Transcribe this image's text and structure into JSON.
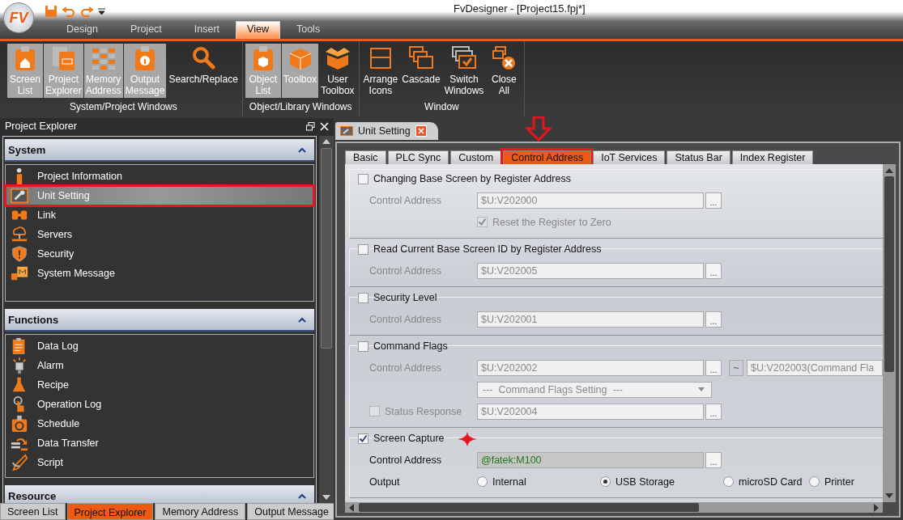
{
  "window": {
    "title": "FvDesigner - [Project15.fpj*]",
    "logo_text": "FV"
  },
  "ribbon_tabs": [
    {
      "label": "Design",
      "selected": false
    },
    {
      "label": "Project",
      "selected": false
    },
    {
      "label": "Insert",
      "selected": false
    },
    {
      "label": "View",
      "selected": true
    },
    {
      "label": "Tools",
      "selected": false
    }
  ],
  "ribbon_groups": [
    {
      "label": "System/Project Windows",
      "buttons": [
        {
          "label": "Screen\nList",
          "on": true
        },
        {
          "label": "Project\nExplorer",
          "on": true
        },
        {
          "label": "Memory\nAddress",
          "on": true
        },
        {
          "label": "Output\nMessage",
          "on": true
        },
        {
          "label": "Search/Replace",
          "on": false
        }
      ]
    },
    {
      "label": "Object/Library Windows",
      "buttons": [
        {
          "label": "Object\nList",
          "on": true
        },
        {
          "label": "Toolbox",
          "on": true
        },
        {
          "label": "User\nToolbox",
          "on": false
        }
      ]
    },
    {
      "label": "Window",
      "buttons": [
        {
          "label": "Arrange\nIcons",
          "on": false
        },
        {
          "label": "Cascade",
          "on": false
        },
        {
          "label": "Switch\nWindows",
          "on": false
        },
        {
          "label": "Close\nAll",
          "on": false
        }
      ]
    }
  ],
  "explorer": {
    "title": "Project Explorer",
    "sections": [
      {
        "title": "System",
        "expanded": true,
        "items": [
          {
            "label": "Project Information",
            "selected": false,
            "highlighted": false
          },
          {
            "label": "Unit Setting",
            "selected": true,
            "highlighted": true
          },
          {
            "label": "Link",
            "selected": false,
            "highlighted": false
          },
          {
            "label": "Servers",
            "selected": false,
            "highlighted": false
          },
          {
            "label": "Security",
            "selected": false,
            "highlighted": false
          },
          {
            "label": "System Message",
            "selected": false,
            "highlighted": false
          }
        ]
      },
      {
        "title": "Functions",
        "expanded": true,
        "items": [
          {
            "label": "Data Log",
            "selected": false,
            "highlighted": false
          },
          {
            "label": "Alarm",
            "selected": false,
            "highlighted": false
          },
          {
            "label": "Recipe",
            "selected": false,
            "highlighted": false
          },
          {
            "label": "Operation Log",
            "selected": false,
            "highlighted": false
          },
          {
            "label": "Schedule",
            "selected": false,
            "highlighted": false
          },
          {
            "label": "Data Transfer",
            "selected": false,
            "highlighted": false
          },
          {
            "label": "Script",
            "selected": false,
            "highlighted": false
          }
        ]
      },
      {
        "title": "Resource",
        "expanded": true
      }
    ]
  },
  "bottom_tabs": [
    {
      "label": "Screen List",
      "selected": false
    },
    {
      "label": "Project Explorer",
      "selected": true
    },
    {
      "label": "Memory Address",
      "selected": false
    },
    {
      "label": "Output Message",
      "selected": false
    }
  ],
  "document_tab": {
    "title": "Unit Setting"
  },
  "settings_tabs": [
    {
      "label": "Basic",
      "selected": false,
      "highlighted": false
    },
    {
      "label": "PLC Sync",
      "selected": false,
      "highlighted": false
    },
    {
      "label": "Custom",
      "selected": false,
      "highlighted": false
    },
    {
      "label": "Control Address",
      "selected": true,
      "highlighted": true
    },
    {
      "label": "IoT Services",
      "selected": false,
      "highlighted": false
    },
    {
      "label": "Status Bar",
      "selected": false,
      "highlighted": false
    },
    {
      "label": "Index Register",
      "selected": false,
      "highlighted": false
    }
  ],
  "groups": [
    {
      "title": "Changing Base Screen by Register Address",
      "checked": false,
      "rows": [
        {
          "kind": "field",
          "label": "Control Address",
          "value": "$U:V202000",
          "button": "..."
        },
        {
          "kind": "check",
          "label": "Reset the Register to Zero",
          "checked": true
        }
      ]
    },
    {
      "title": "Read Current Base Screen ID by Register Address",
      "checked": false,
      "rows": [
        {
          "kind": "field",
          "label": "Control Address",
          "value": "$U:V202005",
          "button": "..."
        }
      ]
    },
    {
      "title": "Security Level",
      "checked": false,
      "rows": [
        {
          "kind": "field",
          "label": "Control Address",
          "value": "$U:V202001",
          "button": "..."
        }
      ]
    },
    {
      "title": "Command Flags",
      "checked": false,
      "rows": [
        {
          "kind": "field",
          "label": "Control Address",
          "value": "$U:V202002",
          "button": "...",
          "range_button": "~",
          "range_value": "$U:V202003(Command Fla"
        },
        {
          "kind": "dropdown",
          "value": "---  Command Flags Setting  ---"
        },
        {
          "kind": "checkfield",
          "label": "Status Response",
          "checked": false,
          "value": "$U:V202004",
          "button": "..."
        }
      ]
    },
    {
      "title": "Screen Capture",
      "checked": true,
      "rows": [
        {
          "kind": "field",
          "label": "Control Address",
          "value": "@fatek:M100",
          "button": "..."
        },
        {
          "kind": "radios",
          "label": "Output",
          "options": [
            {
              "label": "Internal",
              "selected": false
            },
            {
              "label": "USB Storage",
              "selected": true
            },
            {
              "label": "microSD Card",
              "selected": false
            },
            {
              "label": "Printer",
              "selected": false
            }
          ]
        }
      ]
    }
  ]
}
